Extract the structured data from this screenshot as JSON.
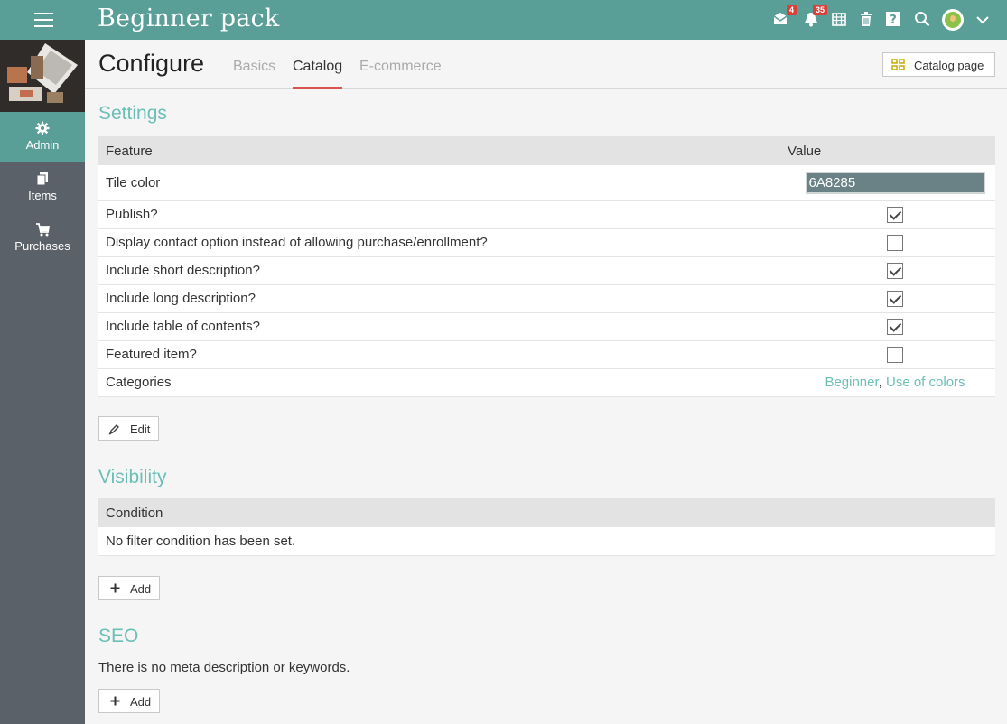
{
  "app": {
    "title": "Beginner pack"
  },
  "topbar": {
    "mail_badge": "4",
    "notifications_badge": "35"
  },
  "sidebar": {
    "items": [
      {
        "label": "Admin",
        "icon": "gear-icon",
        "active": true
      },
      {
        "label": "Items",
        "icon": "documents-icon",
        "active": false
      },
      {
        "label": "Purchases",
        "icon": "cart-icon",
        "active": false
      }
    ]
  },
  "page": {
    "title": "Configure",
    "tabs": [
      {
        "label": "Basics",
        "active": false
      },
      {
        "label": "Catalog",
        "active": true
      },
      {
        "label": "E-commerce",
        "active": false
      }
    ],
    "catalog_page_button": "Catalog page"
  },
  "settings": {
    "title": "Settings",
    "col_feature": "Feature",
    "col_value": "Value",
    "tile_color_label": "Tile color",
    "tile_color_value": "6A8285",
    "rows": [
      {
        "label": "Publish?",
        "checked": true
      },
      {
        "label": "Display contact option instead of allowing purchase/enrollment?",
        "checked": false
      },
      {
        "label": "Include short description?",
        "checked": true
      },
      {
        "label": "Include long description?",
        "checked": true
      },
      {
        "label": "Include table of contents?",
        "checked": true
      },
      {
        "label": "Featured item?",
        "checked": false
      }
    ],
    "categories_label": "Categories",
    "categories": [
      "Beginner",
      "Use of colors"
    ],
    "categories_separator": ",",
    "edit_button": "Edit"
  },
  "visibility": {
    "title": "Visibility",
    "col_condition": "Condition",
    "empty_text": "No filter condition has been set.",
    "add_button": "Add"
  },
  "seo": {
    "title": "SEO",
    "empty_text": "There is no meta description or keywords.",
    "add_button": "Add"
  },
  "colors": {
    "topbar": "#5a9e98",
    "sidebar": "#5b6168",
    "accent": "#6bbfb7",
    "tab_underline": "#d9534f",
    "badge": "#d9403a",
    "tile_color": "#6a8285"
  }
}
